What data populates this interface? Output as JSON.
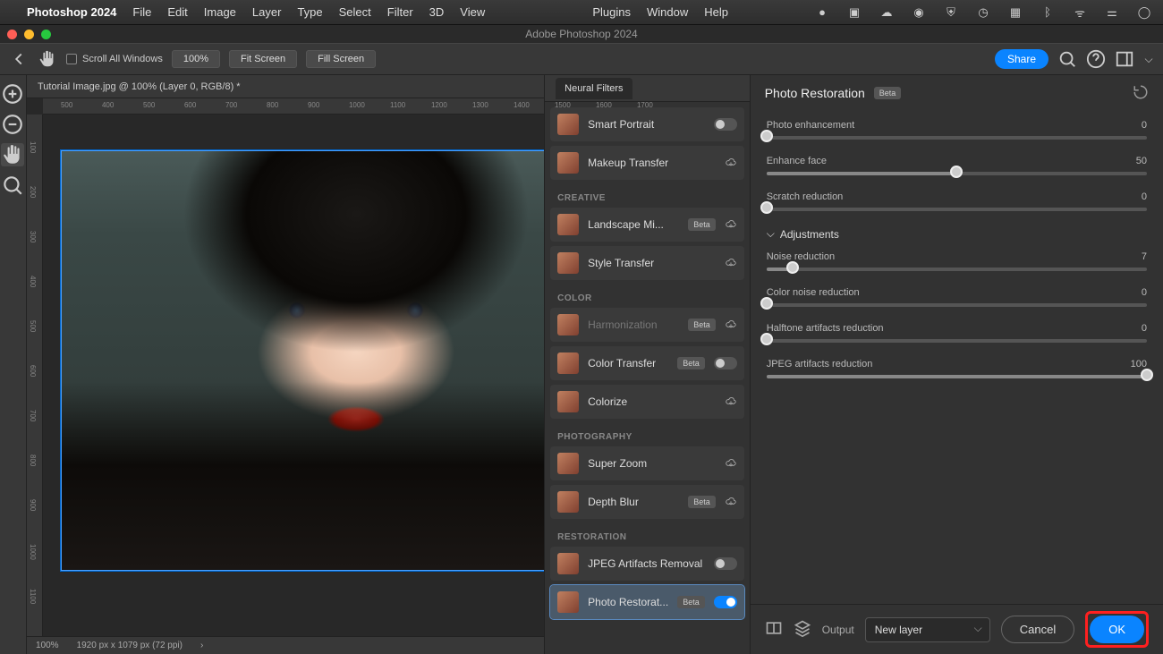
{
  "macmenu": {
    "app": "Photoshop 2024",
    "items": [
      "File",
      "Edit",
      "Image",
      "Layer",
      "Type",
      "Select",
      "Filter",
      "3D",
      "View"
    ],
    "right_items": [
      "Plugins",
      "Window",
      "Help"
    ]
  },
  "window_title": "Adobe Photoshop 2024",
  "optionsbar": {
    "scroll_all": "Scroll All Windows",
    "zoom": "100%",
    "fit": "Fit Screen",
    "fill": "Fill Screen",
    "share": "Share"
  },
  "document": {
    "tab": "Tutorial Image.jpg @ 100% (Layer 0, RGB/8) *",
    "status_zoom": "100%",
    "status_dims": "1920 px x 1079 px (72 ppi)"
  },
  "ruler_h": [
    "500",
    "400",
    "500",
    "600",
    "700",
    "800",
    "900",
    "1000",
    "1100",
    "1200",
    "1300",
    "1400",
    "1500",
    "1600",
    "1700"
  ],
  "ruler_v": [
    "100",
    "200",
    "300",
    "400",
    "500",
    "600",
    "700",
    "800",
    "900",
    "1000",
    "1100"
  ],
  "neural": {
    "panel_title": "Neural Filters",
    "groups": [
      {
        "cat": "",
        "items": [
          {
            "label": "Smart Portrait",
            "beta": false,
            "control": "toggle",
            "on": false
          },
          {
            "label": "Makeup Transfer",
            "beta": false,
            "control": "cloud"
          }
        ]
      },
      {
        "cat": "CREATIVE",
        "items": [
          {
            "label": "Landscape Mi...",
            "beta": true,
            "control": "cloud"
          },
          {
            "label": "Style Transfer",
            "beta": false,
            "control": "cloud"
          }
        ]
      },
      {
        "cat": "COLOR",
        "items": [
          {
            "label": "Harmonization",
            "beta": true,
            "control": "cloud",
            "dim": true
          },
          {
            "label": "Color Transfer",
            "beta": true,
            "control": "toggle",
            "on": false
          },
          {
            "label": "Colorize",
            "beta": false,
            "control": "cloud"
          }
        ]
      },
      {
        "cat": "PHOTOGRAPHY",
        "items": [
          {
            "label": "Super Zoom",
            "beta": false,
            "control": "cloud"
          },
          {
            "label": "Depth Blur",
            "beta": true,
            "control": "cloud"
          }
        ]
      },
      {
        "cat": "RESTORATION",
        "items": [
          {
            "label": "JPEG Artifacts Removal",
            "beta": false,
            "control": "toggle",
            "on": false
          },
          {
            "label": "Photo Restorat...",
            "beta": true,
            "control": "toggle",
            "on": true,
            "sel": true
          }
        ]
      }
    ]
  },
  "settings": {
    "title": "Photo Restoration",
    "title_badge": "Beta",
    "sliders_top": [
      {
        "label": "Photo enhancement",
        "value": 0,
        "pos": 0
      },
      {
        "label": "Enhance face",
        "value": 50,
        "pos": 50
      },
      {
        "label": "Scratch reduction",
        "value": 0,
        "pos": 0
      }
    ],
    "adjustments_label": "Adjustments",
    "sliders_adj": [
      {
        "label": "Noise reduction",
        "value": 7,
        "pos": 7
      },
      {
        "label": "Color noise reduction",
        "value": 0,
        "pos": 0
      },
      {
        "label": "Halftone artifacts reduction",
        "value": 0,
        "pos": 0
      },
      {
        "label": "JPEG artifacts reduction",
        "value": 100,
        "pos": 100
      }
    ]
  },
  "footer": {
    "output_label": "Output",
    "output_value": "New layer",
    "cancel": "Cancel",
    "ok": "OK"
  }
}
